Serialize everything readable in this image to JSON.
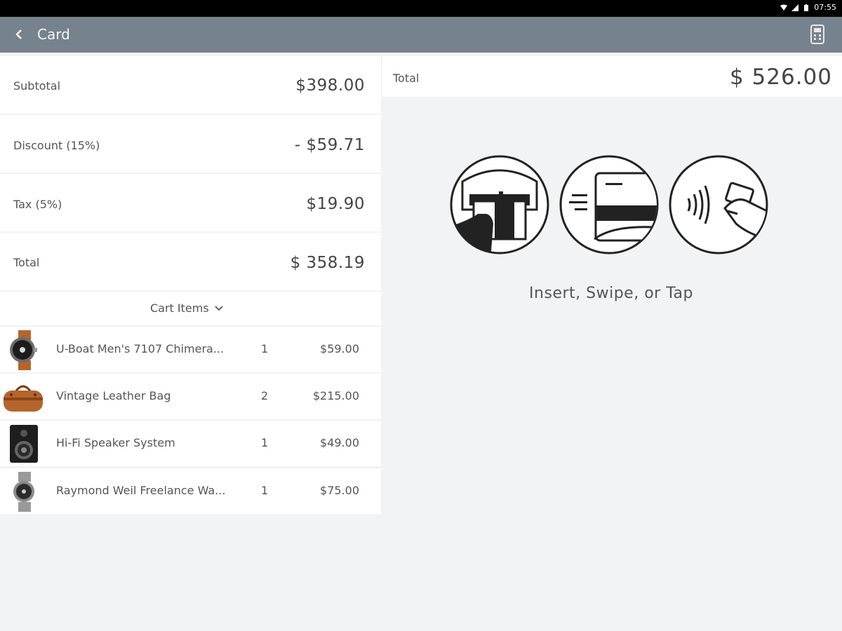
{
  "status_bar": {
    "time": "07:55",
    "icons": [
      "wifi-icon",
      "signal-icon",
      "battery-icon"
    ]
  },
  "app_bar": {
    "title": "Card",
    "back_icon": "chevron-left-icon",
    "reader_icon": "card-reader-icon"
  },
  "summary": {
    "subtotal_label": "Subtotal",
    "subtotal_value": "$398.00",
    "discount_label": "Discount (15%)",
    "discount_value": "- $59.71",
    "tax_label": "Tax (5%)",
    "tax_value": "$19.90",
    "total_label": "Total",
    "total_value": "$ 358.19"
  },
  "cart": {
    "toggle_label": "Cart Items",
    "items": [
      {
        "name": "U-Boat Men's 7107 Chimera...",
        "qty": "1",
        "price": "$59.00",
        "icon": "watch-icon"
      },
      {
        "name": "Vintage Leather Bag",
        "qty": "2",
        "price": "$215.00",
        "icon": "bag-icon"
      },
      {
        "name": "Hi-Fi Speaker System",
        "qty": "1",
        "price": "$49.00",
        "icon": "speaker-icon"
      },
      {
        "name": "Raymond Weil Freelance Wa...",
        "qty": "1",
        "price": "$75.00",
        "icon": "watch-icon"
      }
    ]
  },
  "payment": {
    "total_label": "Total",
    "total_value": "$ 526.00",
    "instruction": "Insert, Swipe, or Tap",
    "methods": [
      "insert-card-icon",
      "swipe-card-icon",
      "tap-card-icon"
    ]
  },
  "colors": {
    "app_bar": "#76828d",
    "background": "#f2f3f5",
    "accent_leather": "#b5652c"
  }
}
